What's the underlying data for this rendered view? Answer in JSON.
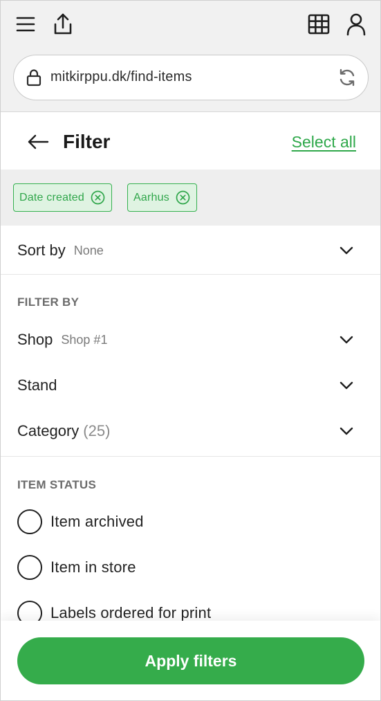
{
  "browser": {
    "url": "mitkirppu.dk/find-items",
    "icons": [
      "menu-icon",
      "share-icon",
      "grid-icon",
      "user-icon",
      "lock-icon",
      "reload-icon"
    ]
  },
  "header": {
    "title": "Filter",
    "select_all": "Select all"
  },
  "chips": [
    {
      "label": "Date created"
    },
    {
      "label": "Aarhus"
    }
  ],
  "sort": {
    "label": "Sort by",
    "value": "None"
  },
  "filter_by": {
    "title": "FILTER BY",
    "shop": {
      "label": "Shop",
      "value": "Shop #1"
    },
    "stand": {
      "label": "Stand"
    },
    "category": {
      "label": "Category",
      "count": "(25)"
    }
  },
  "item_status": {
    "title": "ITEM STATUS",
    "options": [
      {
        "label": "Item archived",
        "checked": false
      },
      {
        "label": "Item in store",
        "checked": false
      },
      {
        "label": "Labels ordered for print",
        "checked": false
      }
    ]
  },
  "footer": {
    "apply_label": "Apply filters"
  },
  "colors": {
    "accent": "#35ac4b",
    "chip_bg": "#dff3e2",
    "chrome_bg": "#f1f1f1"
  }
}
